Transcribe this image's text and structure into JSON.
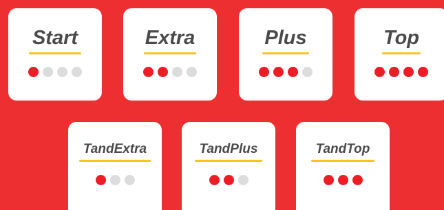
{
  "colors": {
    "background": "#ee2f31",
    "card": "#ffffff",
    "title": "#4a4a4a",
    "underline": "#f5c518",
    "dot_active": "#ee1c25",
    "dot_inactive": "#dcdcdc"
  },
  "plans_top": [
    {
      "name": "Start",
      "level": 1,
      "max": 4
    },
    {
      "name": "Extra",
      "level": 2,
      "max": 4
    },
    {
      "name": "Plus",
      "level": 3,
      "max": 4
    },
    {
      "name": "Top",
      "level": 4,
      "max": 4
    }
  ],
  "plans_bottom": [
    {
      "name": "TandExtra",
      "level": 1,
      "max": 3
    },
    {
      "name": "TandPlus",
      "level": 2,
      "max": 3
    },
    {
      "name": "TandTop",
      "level": 3,
      "max": 3
    }
  ]
}
